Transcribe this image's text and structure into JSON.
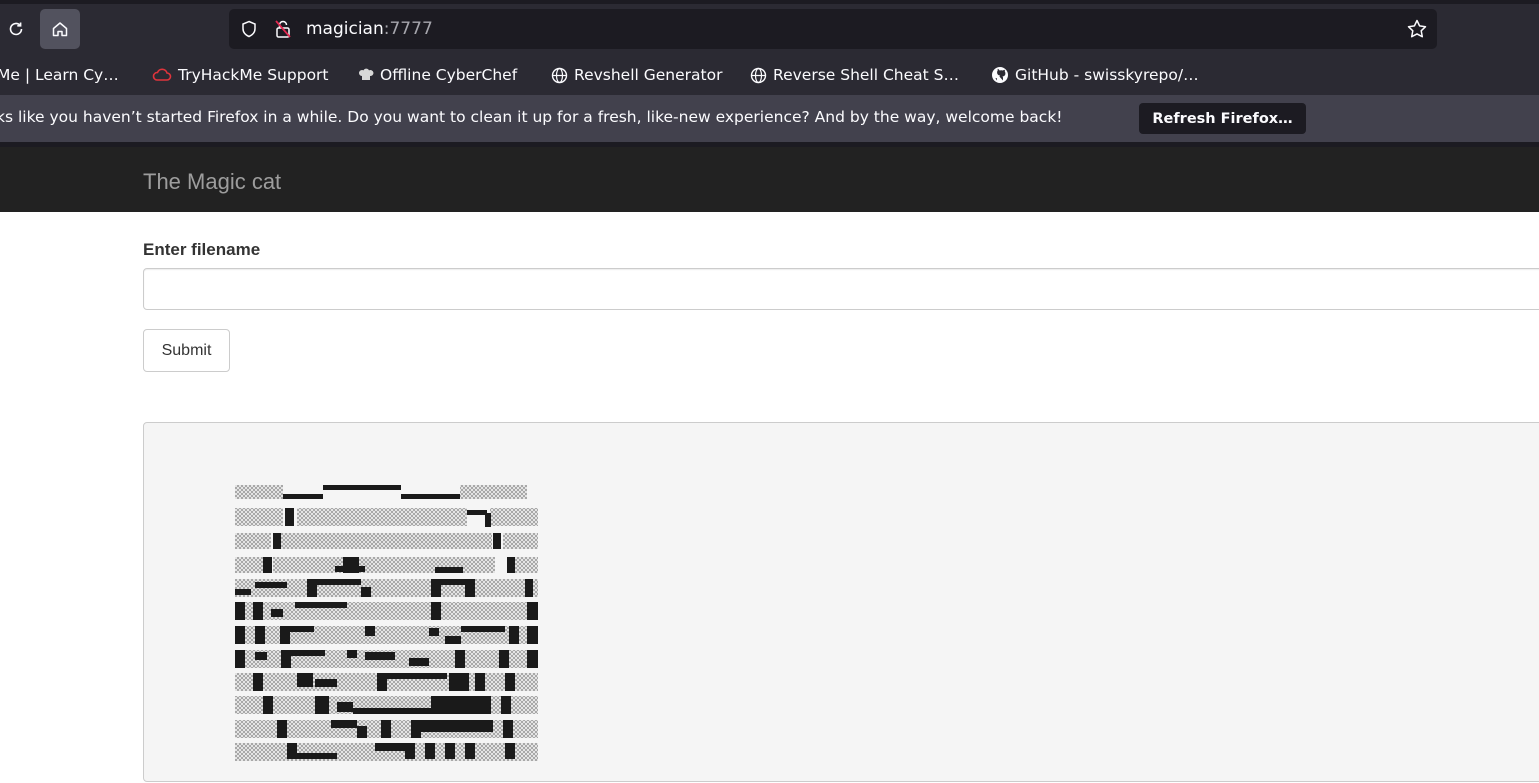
{
  "browser": {
    "url_host": "magician",
    "url_port": ":7777",
    "bookmarks": [
      "Me | Learn Cy…",
      "TryHackMe Support",
      "Offline CyberChef",
      "Revshell Generator",
      "Reverse Shell Cheat S…",
      "GitHub - swisskyrepo/…"
    ],
    "notification_text": "ks like you haven’t started Firefox in a while. Do you want to clean it up for a fresh, like-new experience? And by the way, welcome back!",
    "refresh_button": "Refresh Firefox…"
  },
  "page": {
    "brand": "The Magic cat",
    "filename_label": "Enter filename",
    "filename_value": "",
    "submit_label": "Submit"
  },
  "colors": {
    "navbar": "#222222",
    "brand_text": "#9d9d9d",
    "output_bg": "#f5f5f5",
    "ascii_dark": "#1a1a1a",
    "ascii_shade": "#b8b8b8"
  }
}
